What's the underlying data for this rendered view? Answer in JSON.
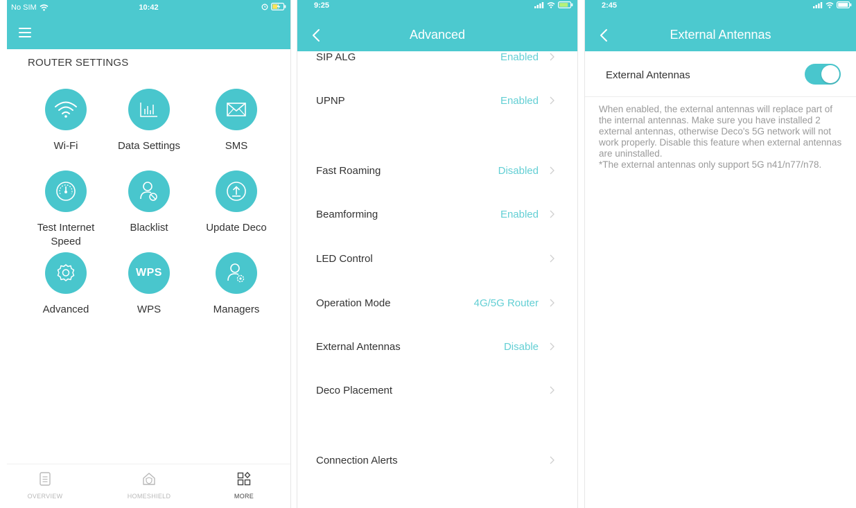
{
  "screen1": {
    "status": {
      "carrier": "No SIM",
      "time": "10:42"
    },
    "section_title": "ROUTER SETTINGS",
    "tiles": [
      {
        "label": "Wi-Fi",
        "icon": "wifi-icon"
      },
      {
        "label": "Data Settings",
        "icon": "bar-chart-icon"
      },
      {
        "label": "SMS",
        "icon": "envelope-icon"
      },
      {
        "label": "Test Internet Speed",
        "icon": "speedometer-icon"
      },
      {
        "label": "Blacklist",
        "icon": "user-blocked-icon"
      },
      {
        "label": "Update Deco",
        "icon": "upload-icon"
      },
      {
        "label": "Advanced",
        "icon": "gear-icon"
      },
      {
        "label": "WPS",
        "icon": "wps-icon",
        "badge": "WPS"
      },
      {
        "label": "Managers",
        "icon": "user-settings-icon"
      }
    ],
    "tabs": [
      {
        "label": "OVERVIEW",
        "icon": "document-icon"
      },
      {
        "label": "HOMESHIELD",
        "icon": "home-shield-icon"
      },
      {
        "label": "MORE",
        "icon": "grid-icon",
        "active": true
      }
    ]
  },
  "screen2": {
    "status": {
      "time": "9:25"
    },
    "title": "Advanced",
    "rows": [
      {
        "label": "SIP ALG",
        "value": "Enabled"
      },
      {
        "label": "UPNP",
        "value": "Enabled"
      },
      {
        "label": "Fast Roaming",
        "value": "Disabled"
      },
      {
        "label": "Beamforming",
        "value": "Enabled"
      },
      {
        "label": "LED Control",
        "value": ""
      },
      {
        "label": "Operation Mode",
        "value": "4G/5G Router"
      },
      {
        "label": "External Antennas",
        "value": "Disable"
      },
      {
        "label": "Deco Placement",
        "value": ""
      },
      {
        "label": "Connection Alerts",
        "value": ""
      }
    ]
  },
  "screen3": {
    "status": {
      "time": "2:45"
    },
    "title": "External Antennas",
    "toggle_label": "External Antennas",
    "toggle_on": true,
    "description": "When enabled, the external antennas will replace part of the internal antennas. Make sure you have installed 2 external antennas, otherwise Deco's 5G network will not work properly. Disable this feature when external antennas are uninstalled.",
    "note": "*The external antennas only support 5G n41/n77/n78."
  },
  "colors": {
    "accent": "#4cc9cf",
    "value_text": "#63cfd4"
  }
}
